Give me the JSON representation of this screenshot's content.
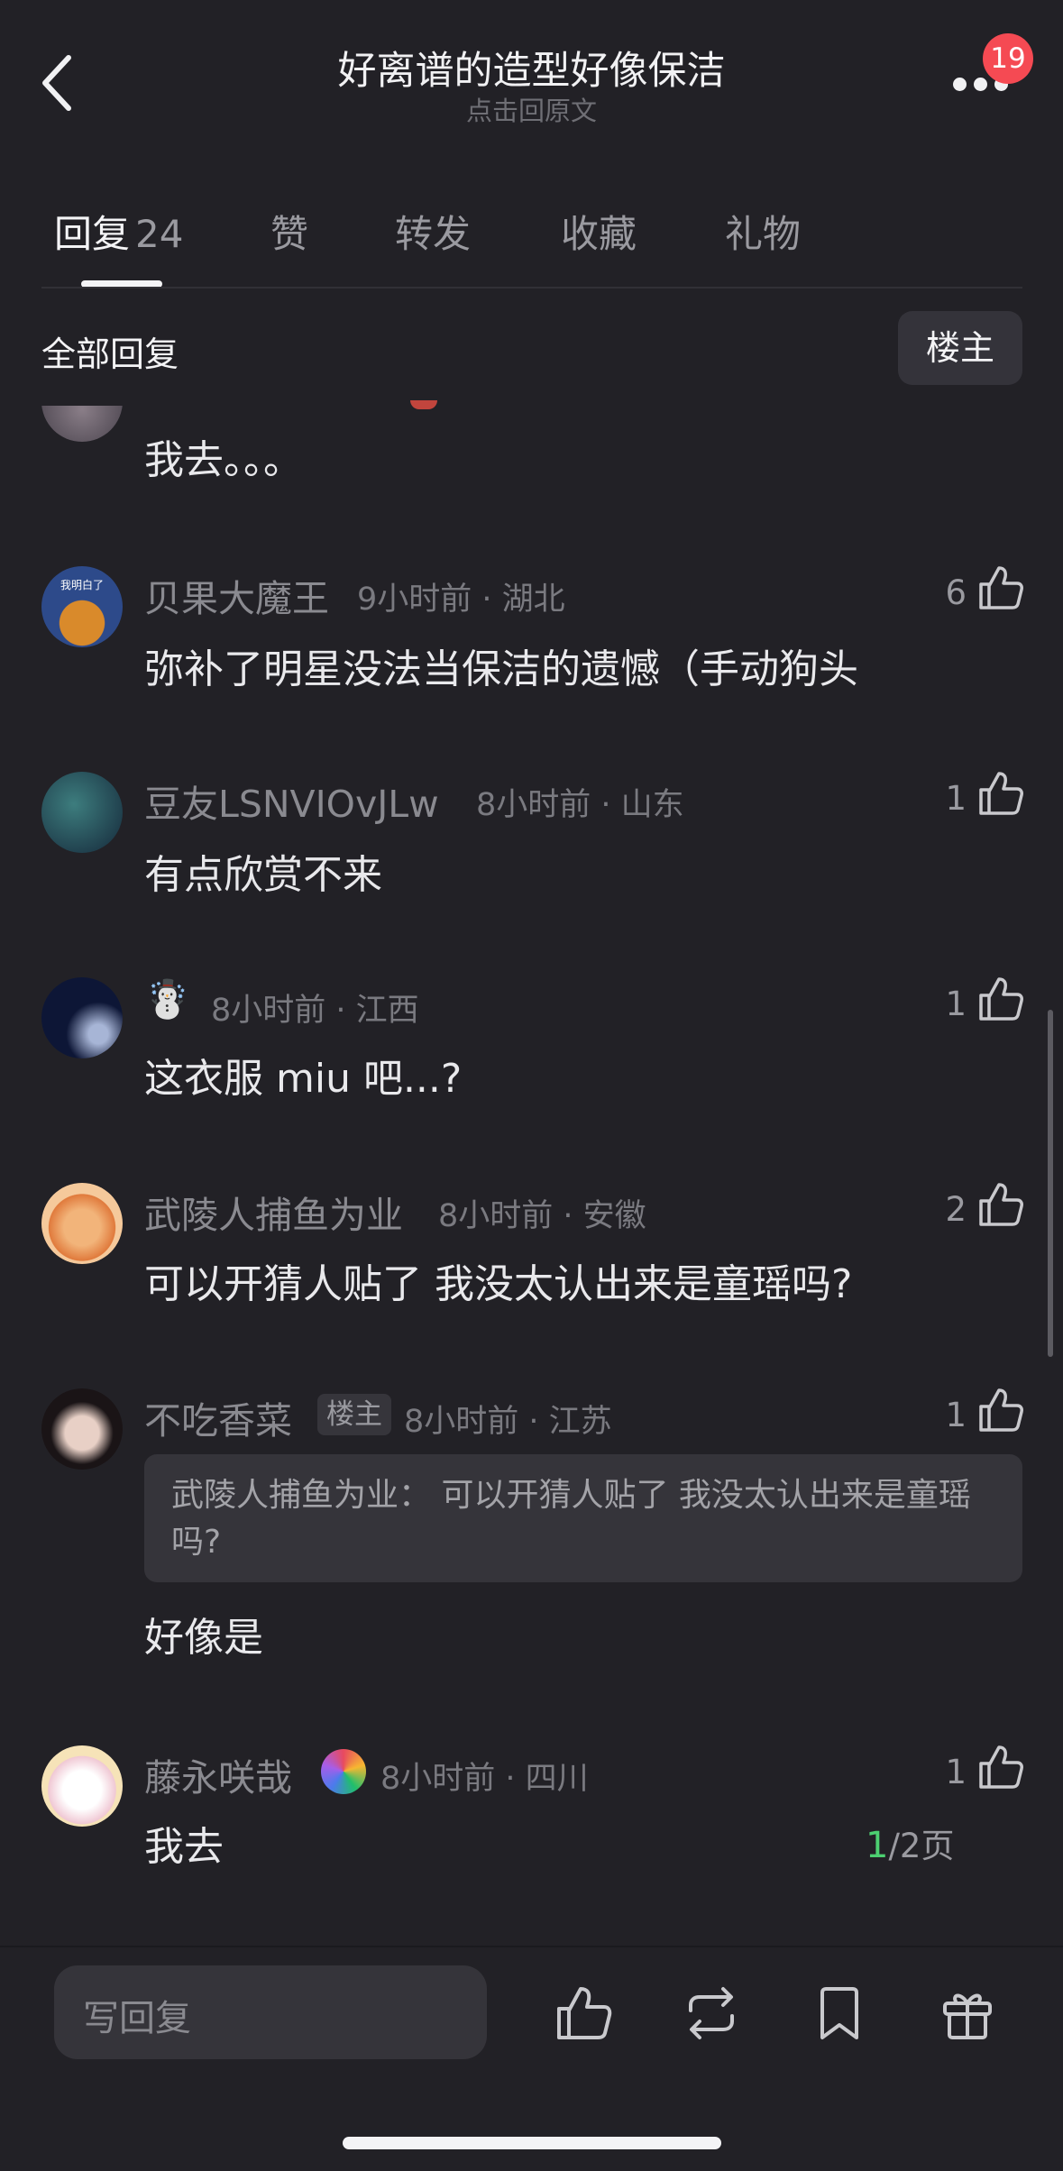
{
  "header": {
    "title": "好离谱的造型好像保洁",
    "subtitle": "点击回原文",
    "notification_count": "19"
  },
  "tabs": {
    "reply": "回复",
    "reply_count": "24",
    "like": "赞",
    "forward": "转发",
    "collect": "收藏",
    "gift": "礼物"
  },
  "filter": {
    "label": "全部回复",
    "op_only": "楼主"
  },
  "comments": [
    {
      "body": "我去。。。"
    },
    {
      "name": "贝果大魔王",
      "meta": "9小时前 · 湖北",
      "body": "弥补了明星没法当保洁的遗憾（手动狗头",
      "likes": "6",
      "avatar_text": "我明白了"
    },
    {
      "name": "豆友LSNVIOvJLw",
      "meta": "8小时前 · 山东",
      "body": "有点欣赏不来",
      "likes": "1"
    },
    {
      "name": "☃️",
      "meta": "8小时前 · 江西",
      "body": "这衣服 miu 吧...?",
      "likes": "1"
    },
    {
      "name": "武陵人捕鱼为业",
      "meta": "8小时前 · 安徽",
      "body": "可以开猜人贴了 我没太认出来是童瑶吗?",
      "likes": "2"
    },
    {
      "name": "不吃香菜",
      "tag": "楼主",
      "meta": "8小时前 · 江苏",
      "quote": "武陵人捕鱼为业： 可以开猜人贴了 我没太认出来是童瑶吗?",
      "body": "好像是",
      "likes": "1"
    },
    {
      "name": "藤永咲哉",
      "meta": "8小时前 · 四川",
      "body": "我去",
      "likes": "1"
    }
  ],
  "pager": {
    "current": "1",
    "rest": "/2页"
  },
  "bottom": {
    "placeholder": "写回复"
  },
  "colors": {
    "background": "#222126",
    "badge": "#f54a53",
    "page_current": "#4ccf71"
  },
  "icons": [
    "back-arrow-icon",
    "more-icon",
    "thumbs-up-icon",
    "repost-icon",
    "bookmark-icon",
    "gift-icon"
  ]
}
